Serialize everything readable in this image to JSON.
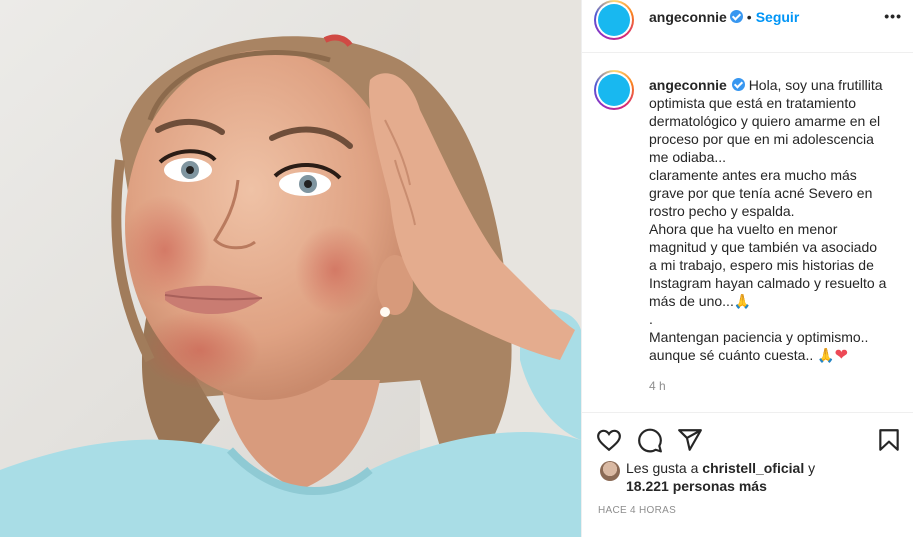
{
  "post": {
    "username": "angeconnie",
    "follow_label": "Seguir",
    "dot": "•",
    "more_label": "•••"
  },
  "caption": {
    "username": "angeconnie",
    "lines": [
      "Hola, soy una frutillita",
      "optimista que está en tratamiento",
      "dermatológico y quiero amarme en el",
      "proceso por que en mi adolescencia",
      "me odiaba...",
      "claramente antes era mucho más",
      "grave por que tenía acné Severo en",
      "rostro pecho y espalda.",
      "Ahora que ha vuelto en menor",
      "magnitud y que también va asociado",
      "a mi trabajo, espero mis historias de",
      "Instagram hayan calmado y resuelto a",
      "más de uno...",
      ".",
      "Mantengan paciencia y optimismo..",
      "aunque sé cuánto cuesta.."
    ],
    "emoji_pray": "🙏",
    "emoji_heart": "❤",
    "time_ago": "4 h"
  },
  "likes": {
    "prefix": "Les gusta a",
    "user": "christell_oficial",
    "suffix": "y",
    "count": "18.221 personas más"
  },
  "posted_ago": "HACE 4 HORAS",
  "icons": {
    "like": "heart-outline-icon",
    "comment": "comment-icon",
    "share": "paper-plane-icon",
    "save": "bookmark-icon"
  },
  "colors": {
    "follow": "#0095f6",
    "verified": "#3897f0",
    "muted": "#8e8e8e",
    "avatar": "#18b8f0"
  }
}
